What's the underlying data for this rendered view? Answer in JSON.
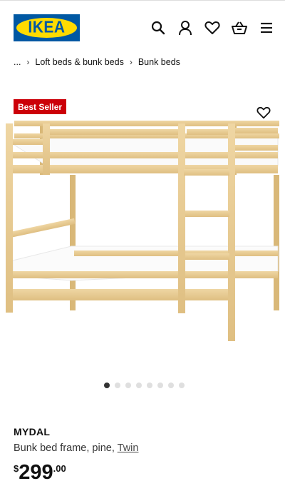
{
  "header": {
    "logo_text": "IKEA",
    "icons": [
      "search-icon",
      "account-icon",
      "heart-icon",
      "cart-icon",
      "menu-icon"
    ]
  },
  "breadcrumb": {
    "ellipsis": "...",
    "items": [
      "Loft beds & bunk beds",
      "Bunk beds"
    ]
  },
  "badge": {
    "label": "Best Seller"
  },
  "gallery": {
    "count": 8,
    "active_index": 0
  },
  "product": {
    "name": "MYDAL",
    "description": "Bunk bed frame, pine,",
    "size_link": "Twin",
    "price": {
      "currency": "$",
      "integer": "299",
      "decimal": ".00"
    }
  },
  "colors": {
    "brand_blue": "#0058a3",
    "brand_yellow": "#ffdb00",
    "badge_red": "#cc0008",
    "wood": "#e6c88c"
  }
}
